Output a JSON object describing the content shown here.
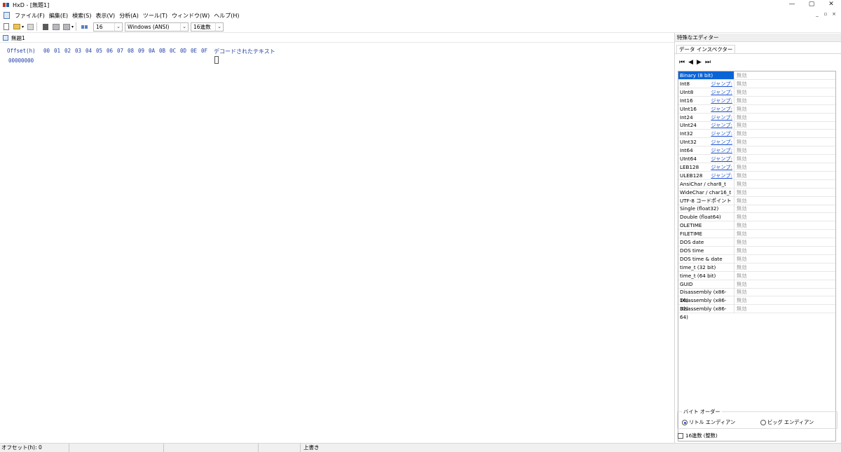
{
  "window": {
    "title": "HxD - [無題1]",
    "minimize": "—",
    "maximize": "▢",
    "close": "✕"
  },
  "menu": {
    "items": [
      "ファイル(F)",
      "編集(E)",
      "検索(S)",
      "表示(V)",
      "分析(A)",
      "ツール(T)",
      "ウィンドウ(W)",
      "ヘルプ(H)"
    ],
    "mdi_minimize": "_",
    "mdi_restore": "▫",
    "mdi_close": "×"
  },
  "toolbar": {
    "bytes_per_row": "16",
    "charset": "Windows (ANSI)",
    "offset_base": "16進数",
    "dropdown_glyph": "▾"
  },
  "document": {
    "tab_label": "無題1"
  },
  "hexview": {
    "offset_header": "Offset(h)",
    "columns": [
      "00",
      "01",
      "02",
      "03",
      "04",
      "05",
      "06",
      "07",
      "08",
      "09",
      "0A",
      "0B",
      "0C",
      "0D",
      "0E",
      "0F"
    ],
    "decoded_header": "デコードされたテキスト",
    "first_offset": "00000000"
  },
  "inspector": {
    "panel_title": "特殊なエディター",
    "tab_label": "データ インスペクター",
    "nav": {
      "first": "⏮",
      "prev": "◀",
      "next": "▶",
      "last": "⏭"
    },
    "jump_label": "ジャンプ:",
    "invalid_value": "無効",
    "rows": [
      {
        "name": "Binary (8 bit)",
        "jump": false,
        "selected": true
      },
      {
        "name": "Int8",
        "jump": true
      },
      {
        "name": "UInt8",
        "jump": true
      },
      {
        "name": "Int16",
        "jump": true
      },
      {
        "name": "UInt16",
        "jump": true
      },
      {
        "name": "Int24",
        "jump": true
      },
      {
        "name": "UInt24",
        "jump": true
      },
      {
        "name": "Int32",
        "jump": true
      },
      {
        "name": "UInt32",
        "jump": true
      },
      {
        "name": "Int64",
        "jump": true
      },
      {
        "name": "UInt64",
        "jump": true
      },
      {
        "name": "LEB128",
        "jump": true
      },
      {
        "name": "ULEB128",
        "jump": true
      },
      {
        "name": "AnsiChar / char8_t",
        "jump": false
      },
      {
        "name": "WideChar / char16_t",
        "jump": false
      },
      {
        "name": "UTF-8 コードポイント",
        "jump": false
      },
      {
        "name": "Single (float32)",
        "jump": false
      },
      {
        "name": "Double (float64)",
        "jump": false
      },
      {
        "name": "OLETIME",
        "jump": false
      },
      {
        "name": "FILETIME",
        "jump": false
      },
      {
        "name": "DOS date",
        "jump": false
      },
      {
        "name": "DOS time",
        "jump": false
      },
      {
        "name": "DOS time & date",
        "jump": false
      },
      {
        "name": "time_t (32 bit)",
        "jump": false
      },
      {
        "name": "time_t (64 bit)",
        "jump": false
      },
      {
        "name": "GUID",
        "jump": false
      },
      {
        "name": "Disassembly (x86-16)",
        "jump": false
      },
      {
        "name": "Disassembly (x86-32)",
        "jump": false
      },
      {
        "name": "Disassembly (x86-64)",
        "jump": false
      }
    ],
    "byte_order": {
      "legend": "バイト オーダー",
      "little": "リトル エンディアン",
      "big": "ビッグ エンディアン",
      "selected": "little"
    },
    "hex_checkbox": "16進数 (整数)"
  },
  "statusbar": {
    "offset": "オフセット(h): 0",
    "mode": "上書き"
  }
}
